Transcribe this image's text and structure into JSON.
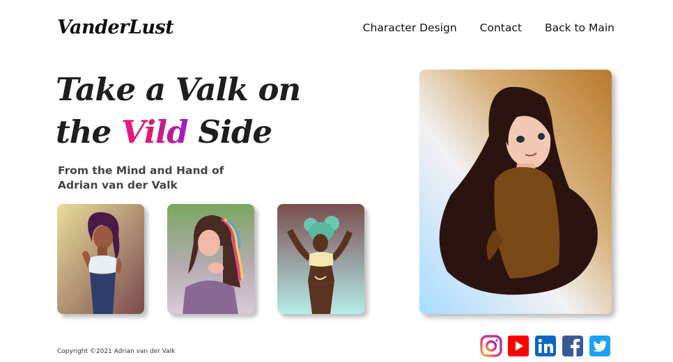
{
  "brand": {
    "logo": "VanderLust"
  },
  "nav": {
    "items": [
      {
        "label": "Character Design"
      },
      {
        "label": "Contact"
      },
      {
        "label": "Back to Main"
      }
    ]
  },
  "hero": {
    "line1": "Take a Valk on",
    "line2_start": "the ",
    "line2_accent": "Vild",
    "line2_end": " Side",
    "subtitle_line1": "From the Mind and Hand of",
    "subtitle_line2": "Adrian van der Valk"
  },
  "gallery": {
    "thumbnails": [
      {
        "icon": "character-illustration-purple-hair"
      },
      {
        "icon": "character-illustration-rainbow-hair"
      },
      {
        "icon": "character-illustration-teal-hair"
      }
    ],
    "featured": {
      "icon": "character-illustration-brown-hair"
    }
  },
  "footer": {
    "copyright": "Copyright ©2021 Adrian van der Valk",
    "social": [
      {
        "icon": "instagram-icon",
        "color": "#d6249f"
      },
      {
        "icon": "youtube-icon",
        "color": "#ff0000"
      },
      {
        "icon": "linkedin-icon",
        "color": "#0a66c2"
      },
      {
        "icon": "facebook-icon",
        "color": "#3b5998"
      },
      {
        "icon": "twitter-icon",
        "color": "#1da1f2"
      }
    ]
  },
  "colors": {
    "accent_start": "#f0148c",
    "accent_end": "#9b1fc8",
    "text": "#1e1e1e"
  }
}
